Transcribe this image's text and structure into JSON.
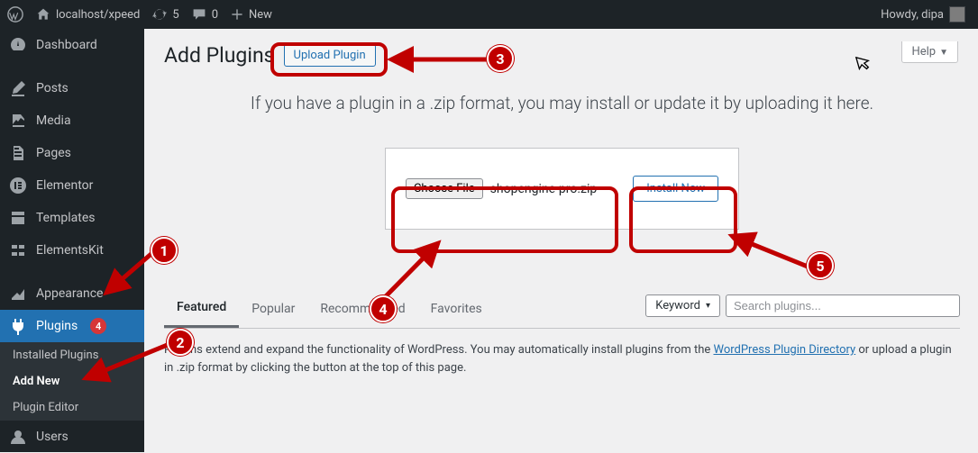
{
  "adminbar": {
    "site_name": "localhost/xpeed",
    "updates_count": "5",
    "comments_count": "0",
    "new_label": "New",
    "howdy": "Howdy, dipa"
  },
  "sidebar": {
    "items": [
      {
        "label": "Dashboard"
      },
      {
        "label": "Posts"
      },
      {
        "label": "Media"
      },
      {
        "label": "Pages"
      },
      {
        "label": "Elementor"
      },
      {
        "label": "Templates"
      },
      {
        "label": "ElementsKit"
      },
      {
        "label": "Appearance"
      },
      {
        "label": "Plugins",
        "badge": "4"
      },
      {
        "label": "Users"
      }
    ],
    "submenu": {
      "installed": "Installed Plugins",
      "add_new": "Add New",
      "editor": "Plugin Editor"
    }
  },
  "page": {
    "title": "Add Plugins",
    "upload_button": "Upload Plugin",
    "help_label": "Help",
    "upload_msg": "If you have a plugin in a .zip format, you may install or update it by uploading it here.",
    "choose_file_btn": "Choose File",
    "chosen_file": "shopengine-pro.zip",
    "install_now_btn": "Install Now",
    "tabs": [
      "Featured",
      "Popular",
      "Recommended",
      "Favorites"
    ],
    "keyword_label": "Keyword",
    "search_placeholder": "Search plugins...",
    "description_pre": "Plugins extend and expand the functionality of WordPress. You may automatically install plugins from the ",
    "description_link": "WordPress Plugin Directory",
    "description_post": " or upload a plugin in .zip format by clicking the button at the top of this page."
  },
  "annotations": {
    "n1": "1",
    "n2": "2",
    "n3": "3",
    "n4": "4",
    "n5": "5"
  }
}
